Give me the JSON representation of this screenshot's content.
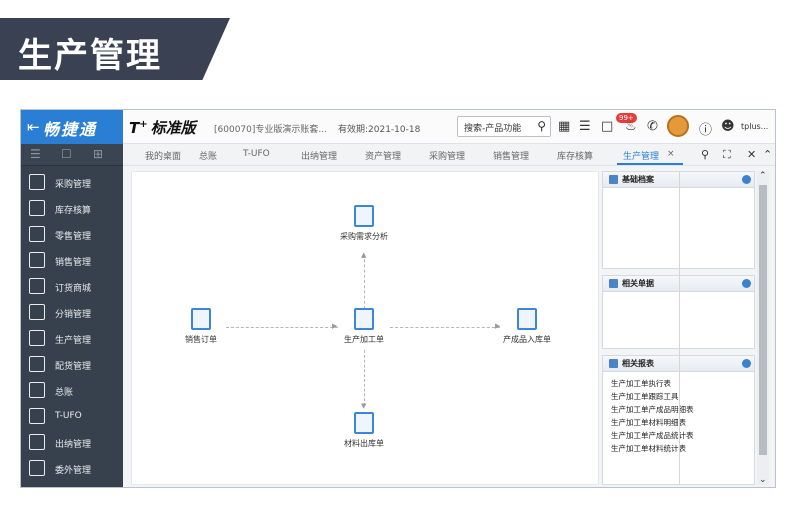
{
  "banner": {
    "title": "生产管理"
  },
  "app": {
    "brand": "畅捷通",
    "product": "T",
    "product_sup": "+",
    "product_suffix": "标准版",
    "account": "[600070]专业版演示账套...",
    "validity": "有效期:2021-10-18",
    "search_placeholder": "搜索-产品功能",
    "notification_count": "99+",
    "user": "tplus..."
  },
  "tabs": [
    {
      "label": "我的桌面"
    },
    {
      "label": "总账"
    },
    {
      "label": "T-UFO"
    },
    {
      "label": "出纳管理"
    },
    {
      "label": "资产管理"
    },
    {
      "label": "采购管理"
    },
    {
      "label": "销售管理"
    },
    {
      "label": "库存核算"
    },
    {
      "label": "生产管理",
      "active": true
    }
  ],
  "tab_close": "×",
  "sidebar": {
    "items": [
      {
        "label": "采购管理",
        "icon": "cart-icon"
      },
      {
        "label": "库存核算",
        "icon": "warehouse-icon"
      },
      {
        "label": "零售管理",
        "icon": "retail-icon"
      },
      {
        "label": "销售管理",
        "icon": "sales-chart-icon"
      },
      {
        "label": "订货商城",
        "icon": "store-icon"
      },
      {
        "label": "分销管理",
        "icon": "distribution-icon"
      },
      {
        "label": "生产管理",
        "icon": "production-icon"
      },
      {
        "label": "配货管理",
        "icon": "allocation-icon"
      },
      {
        "label": "总账",
        "icon": "ledger-icon"
      },
      {
        "label": "T-UFO",
        "icon": "ufo-icon"
      },
      {
        "label": "出纳管理",
        "icon": "cashier-icon"
      },
      {
        "label": "委外管理",
        "icon": "outsource-icon"
      }
    ]
  },
  "flow": {
    "nodes": {
      "purchase_analysis": "采购需求分析",
      "sales_order": "销售订单",
      "production_order": "生产加工单",
      "finished_goods_in": "产成品入库单",
      "material_out": "材料出库单"
    }
  },
  "panels": {
    "basic_files": {
      "title": "基础档案"
    },
    "related_docs": {
      "title": "相关单据"
    },
    "related_reports": {
      "title": "相关报表",
      "links": [
        "生产加工单执行表",
        "生产加工单跟踪工具",
        "生产加工单产成品明细表",
        "生产加工单材料明细表",
        "生产加工单产成品统计表",
        "生产加工单材料统计表"
      ]
    }
  }
}
